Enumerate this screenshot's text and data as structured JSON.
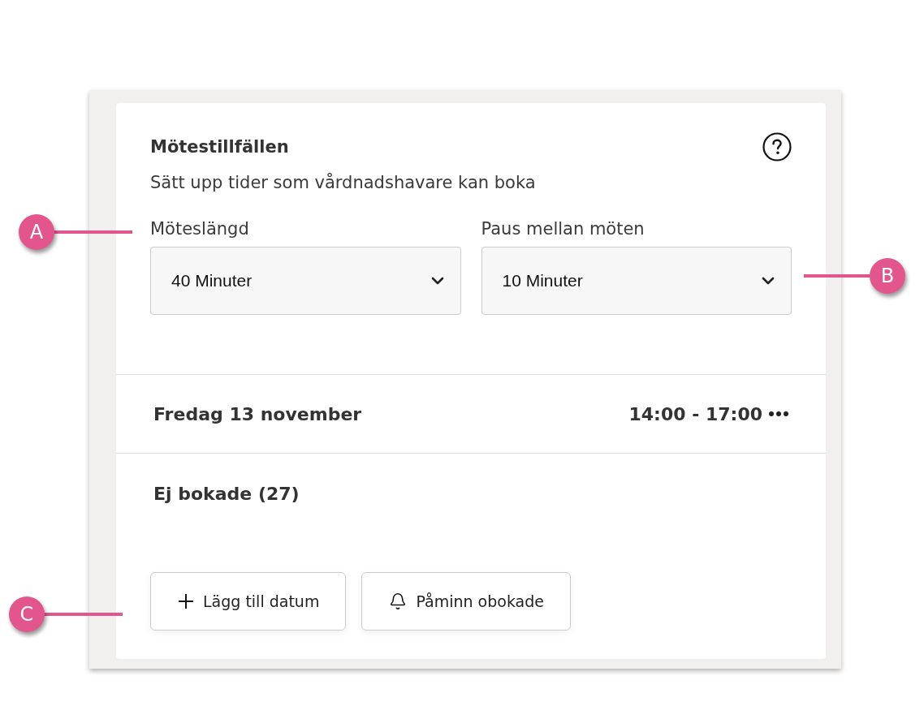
{
  "panel": {
    "title": "Mötestillfällen",
    "subtitle": "Sätt upp tider som vårdnadshavare kan boka"
  },
  "selects": [
    {
      "label": "Möteslängd",
      "value": "40 Minuter"
    },
    {
      "label": "Paus mellan möten",
      "value": "10 Minuter"
    }
  ],
  "dates": [
    {
      "date": "Fredag 13 november",
      "time": "14:00 - 17:00"
    }
  ],
  "unbooked": {
    "label": "Ej bokade (27)"
  },
  "buttons": [
    {
      "label": "Lägg till datum",
      "kind": "add"
    },
    {
      "label": "Påminn obokade",
      "kind": "remind"
    }
  ],
  "callouts": [
    {
      "label": "A"
    },
    {
      "label": "B"
    },
    {
      "label": "C"
    }
  ]
}
